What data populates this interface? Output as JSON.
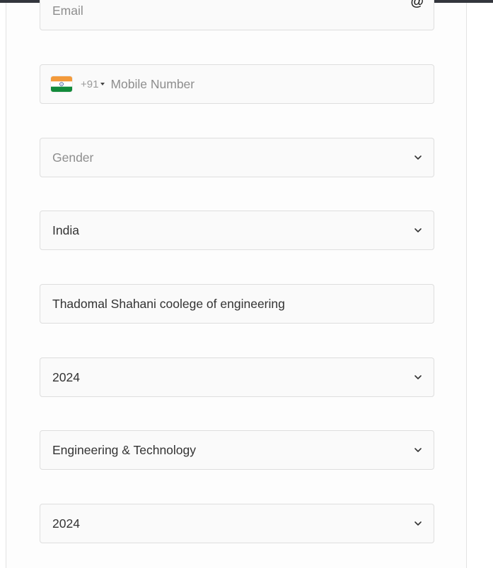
{
  "form": {
    "email": {
      "placeholder": "Email",
      "icon": "@"
    },
    "mobile": {
      "country_flag": "india-flag-icon",
      "dial_code": "+91",
      "placeholder": "Mobile Number"
    },
    "gender": {
      "value": "Gender"
    },
    "country": {
      "value": "India"
    },
    "college": {
      "value": "Thadomal Shahani coolege of engineering"
    },
    "year_1": {
      "value": "2024"
    },
    "stream": {
      "value": "Engineering & Technology"
    },
    "year_2": {
      "value": "2024"
    }
  },
  "colors": {
    "border": "#dedede",
    "field_bg": "#fafafa",
    "placeholder": "#8e8e8e",
    "text": "#333333",
    "top_bar": "#33363d"
  }
}
